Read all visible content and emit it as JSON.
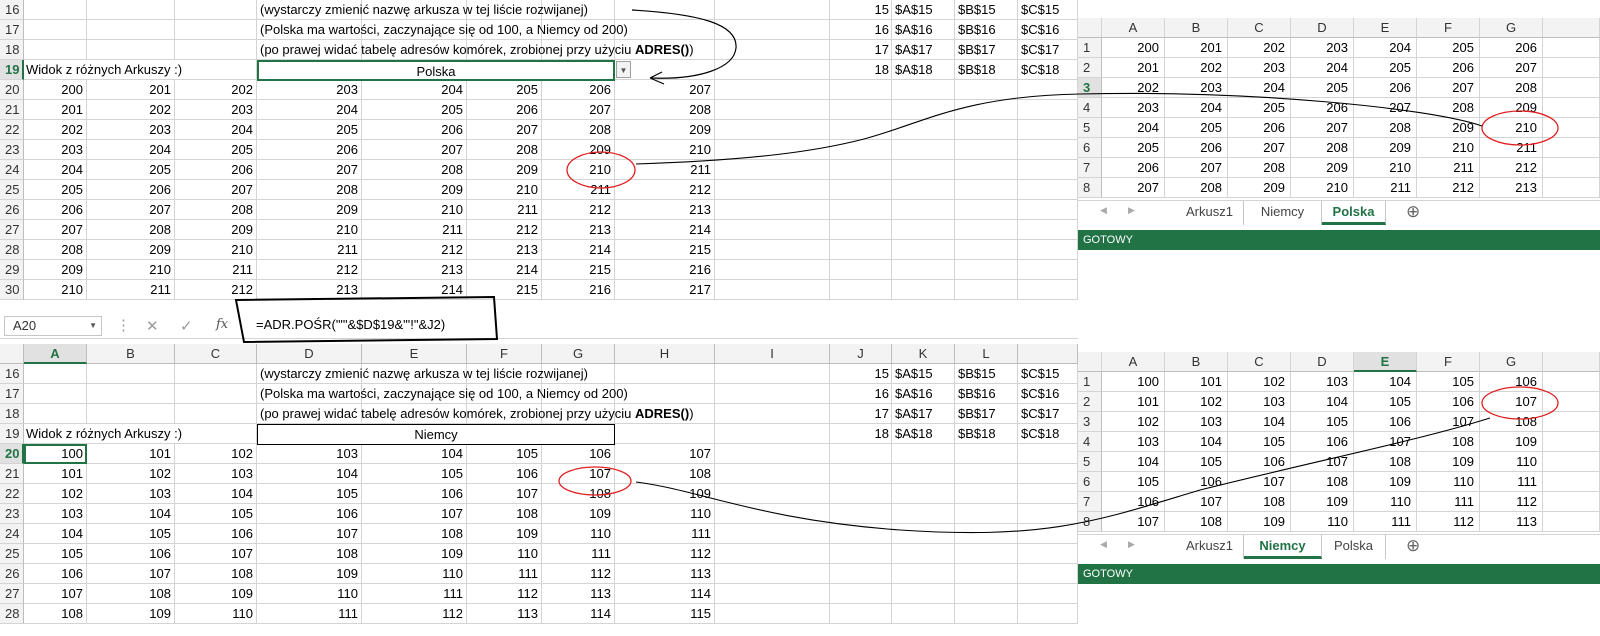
{
  "notes": {
    "line1": "(wystarczy zmienić nazwę arkusza w tej liście rozwijanej)",
    "line2": "(Polska ma wartości, zaczynające się od 100, a Niemcy od 200)",
    "line3_pre": "(po prawej widać tabelę adresów komórek, zrobionej przy użyciu ",
    "line3_bold": "ADRES()",
    "line3_post": ")",
    "view_label": "Widok z różnych Arkuszy :)"
  },
  "addr_table": [
    [
      "15",
      "$A$15",
      "$B$15",
      "$C$15"
    ],
    [
      "16",
      "$A$16",
      "$B$16",
      "$C$16"
    ],
    [
      "17",
      "$A$17",
      "$B$17",
      "$C$17"
    ],
    [
      "18",
      "$A$18",
      "$B$18",
      "$C$18"
    ]
  ],
  "top": {
    "rows": [
      "16",
      "17",
      "18",
      "19",
      "20",
      "21",
      "22",
      "23",
      "24",
      "25",
      "26",
      "27",
      "28",
      "29",
      "30"
    ],
    "dropdown_value": "Polska",
    "data": [
      [
        "200",
        "201",
        "202",
        "203",
        "204",
        "205",
        "206",
        "207"
      ],
      [
        "201",
        "202",
        "203",
        "204",
        "205",
        "206",
        "207",
        "208"
      ],
      [
        "202",
        "203",
        "204",
        "205",
        "206",
        "207",
        "208",
        "209"
      ],
      [
        "203",
        "204",
        "205",
        "206",
        "207",
        "208",
        "209",
        "210"
      ],
      [
        "204",
        "205",
        "206",
        "207",
        "208",
        "209",
        "210",
        "211"
      ],
      [
        "205",
        "206",
        "207",
        "208",
        "209",
        "210",
        "211",
        "212"
      ],
      [
        "206",
        "207",
        "208",
        "209",
        "210",
        "211",
        "212",
        "213"
      ],
      [
        "207",
        "208",
        "209",
        "210",
        "211",
        "212",
        "213",
        "214"
      ],
      [
        "208",
        "209",
        "210",
        "211",
        "212",
        "213",
        "214",
        "215"
      ],
      [
        "209",
        "210",
        "211",
        "212",
        "213",
        "214",
        "215",
        "216"
      ],
      [
        "210",
        "211",
        "212",
        "213",
        "214",
        "215",
        "216",
        "217"
      ]
    ]
  },
  "formula": {
    "namebox": "A20",
    "cancel": "✕",
    "enter": "✓",
    "fx": "fx",
    "text": "=ADR.POŚR(\"'\"&$D$19&\"'!\"&J2)"
  },
  "bottom": {
    "cols": [
      "A",
      "B",
      "C",
      "D",
      "E",
      "F",
      "G",
      "H",
      "I",
      "J",
      "K",
      "L"
    ],
    "rows": [
      "16",
      "17",
      "18",
      "19",
      "20",
      "21",
      "22",
      "23",
      "24",
      "25",
      "26",
      "27",
      "28"
    ],
    "dropdown_value": "Niemcy",
    "data": [
      [
        "100",
        "101",
        "102",
        "103",
        "104",
        "105",
        "106",
        "107"
      ],
      [
        "101",
        "102",
        "103",
        "104",
        "105",
        "106",
        "107",
        "108"
      ],
      [
        "102",
        "103",
        "104",
        "105",
        "106",
        "107",
        "108",
        "109"
      ],
      [
        "103",
        "104",
        "105",
        "106",
        "107",
        "108",
        "109",
        "110"
      ],
      [
        "104",
        "105",
        "106",
        "107",
        "108",
        "109",
        "110",
        "111"
      ],
      [
        "105",
        "106",
        "107",
        "108",
        "109",
        "110",
        "111",
        "112"
      ],
      [
        "106",
        "107",
        "108",
        "109",
        "110",
        "111",
        "112",
        "113"
      ],
      [
        "107",
        "108",
        "109",
        "110",
        "111",
        "112",
        "113",
        "114"
      ],
      [
        "108",
        "109",
        "110",
        "111",
        "112",
        "113",
        "114",
        "115"
      ]
    ]
  },
  "mini_top": {
    "cols": [
      "A",
      "B",
      "C",
      "D",
      "E",
      "F",
      "G"
    ],
    "rows": [
      "1",
      "2",
      "3",
      "4",
      "5",
      "6",
      "7",
      "8"
    ],
    "data": [
      [
        "200",
        "201",
        "202",
        "203",
        "204",
        "205",
        "206"
      ],
      [
        "201",
        "202",
        "203",
        "204",
        "205",
        "206",
        "207"
      ],
      [
        "202",
        "203",
        "204",
        "205",
        "206",
        "207",
        "208"
      ],
      [
        "203",
        "204",
        "205",
        "206",
        "207",
        "208",
        "209"
      ],
      [
        "204",
        "205",
        "206",
        "207",
        "208",
        "209",
        "210"
      ],
      [
        "205",
        "206",
        "207",
        "208",
        "209",
        "210",
        "211"
      ],
      [
        "206",
        "207",
        "208",
        "209",
        "210",
        "211",
        "212"
      ],
      [
        "207",
        "208",
        "209",
        "210",
        "211",
        "212",
        "213"
      ]
    ],
    "tabs": [
      "Arkusz1",
      "Niemcy",
      "Polska"
    ],
    "active_tab": "Polska",
    "status": "GOTOWY"
  },
  "mini_bottom": {
    "cols": [
      "A",
      "B",
      "C",
      "D",
      "E",
      "F",
      "G"
    ],
    "rows": [
      "1",
      "2",
      "3",
      "4",
      "5",
      "6",
      "7",
      "8"
    ],
    "data": [
      [
        "100",
        "101",
        "102",
        "103",
        "104",
        "105",
        "106"
      ],
      [
        "101",
        "102",
        "103",
        "104",
        "105",
        "106",
        "107"
      ],
      [
        "102",
        "103",
        "104",
        "105",
        "106",
        "107",
        "108"
      ],
      [
        "103",
        "104",
        "105",
        "106",
        "107",
        "108",
        "109"
      ],
      [
        "104",
        "105",
        "106",
        "107",
        "108",
        "109",
        "110"
      ],
      [
        "105",
        "106",
        "107",
        "108",
        "109",
        "110",
        "111"
      ],
      [
        "106",
        "107",
        "108",
        "109",
        "110",
        "111",
        "112"
      ],
      [
        "107",
        "108",
        "109",
        "110",
        "111",
        "112",
        "113"
      ]
    ],
    "tabs": [
      "Arkusz1",
      "Niemcy",
      "Polska"
    ],
    "active_tab": "Niemcy",
    "status": "GOTOWY"
  },
  "colors": {
    "excel_green": "#217346",
    "annotation_red": "#e02020",
    "annotation_line": "#000000"
  },
  "icons": {
    "tab_prev": "◀",
    "tab_next": "▶",
    "add_sheet": "⊕",
    "dropdown_arrow": "▼",
    "namebox_arrow": "▼",
    "formula_sep": "⋮"
  }
}
